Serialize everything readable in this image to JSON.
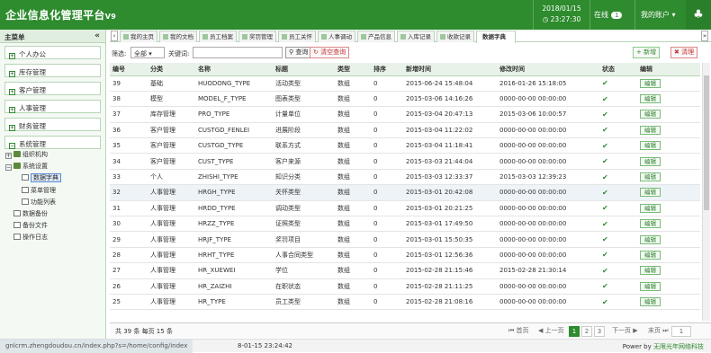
{
  "header": {
    "title": "企业信息化管理平台",
    "version": "V9",
    "date": "2018/01/15",
    "time": "◷ 23:27:30",
    "online_label": "在线",
    "online_count": "1",
    "account_label": "我的账户 ▾",
    "tree_icon": "tree-icon"
  },
  "sidebar": {
    "title": "主菜单",
    "collapse": "«",
    "menus": [
      "个人办公",
      "库存管理",
      "客户管理",
      "人事管理",
      "财务管理",
      "系统管理"
    ],
    "tree": {
      "org": "组织机构",
      "settings": "系统设置",
      "dict": "数据字典",
      "menu": "菜单管理",
      "func": "功能列表",
      "backup": "数据备份",
      "files": "备份文件",
      "log": "操作日志"
    }
  },
  "tabs": [
    "我的主页",
    "我的文档",
    "员工档案",
    "奖罚管理",
    "员工关怀",
    "人事调动",
    "产品信息",
    "入库记录",
    "收款记录",
    "数据字典"
  ],
  "toolbar": {
    "filter_label": "筛选:",
    "filter_value": "全部 ▾",
    "keyword_label": "关键词:",
    "search_btn": "查询",
    "clear_btn": "清空查询",
    "add_btn": "新增",
    "clean_btn": "清理"
  },
  "table": {
    "headers": [
      "编号",
      "分类",
      "名称",
      "标题",
      "类型",
      "排序",
      "新增时间",
      "修改时间",
      "状态",
      "编辑"
    ],
    "rows": [
      [
        "39",
        "基础",
        "HUODONG_TYPE",
        "活动类型",
        "数组",
        "0",
        "2015-06-24 15:48:04",
        "2016-01-26 15:18:05"
      ],
      [
        "38",
        "模型",
        "MODEL_F_TYPE",
        "图表类型",
        "数组",
        "0",
        "2015-03-06 14:16:26",
        "0000-00-00 00:00:00"
      ],
      [
        "37",
        "库存管理",
        "PRO_TYPE",
        "计量单位",
        "数组",
        "0",
        "2015-03-04 20:47:13",
        "2015-03-06 10:00:57"
      ],
      [
        "36",
        "客户管理",
        "CUSTGD_FENLEI",
        "进展阶段",
        "数组",
        "0",
        "2015-03-04 11:22:02",
        "0000-00-00 00:00:00"
      ],
      [
        "35",
        "客户管理",
        "CUSTGD_TYPE",
        "联系方式",
        "数组",
        "0",
        "2015-03-04 11:18:41",
        "0000-00-00 00:00:00"
      ],
      [
        "34",
        "客户管理",
        "CUST_TYPE",
        "客户来源",
        "数组",
        "0",
        "2015-03-03 21:44:04",
        "0000-00-00 00:00:00"
      ],
      [
        "33",
        "个人",
        "ZHISHI_TYPE",
        "知识分类",
        "数组",
        "0",
        "2015-03-03 12:33:37",
        "2015-03-03 12:39:23"
      ],
      [
        "32",
        "人事管理",
        "HRGH_TYPE",
        "关怀类型",
        "数组",
        "0",
        "2015-03-01 20:42:08",
        "0000-00-00 00:00:00"
      ],
      [
        "31",
        "人事管理",
        "HRDD_TYPE",
        "调动类型",
        "数组",
        "0",
        "2015-03-01 20:21:25",
        "0000-00-00 00:00:00"
      ],
      [
        "30",
        "人事管理",
        "HRZZ_TYPE",
        "证照类型",
        "数组",
        "0",
        "2015-03-01 17:49:50",
        "0000-00-00 00:00:00"
      ],
      [
        "29",
        "人事管理",
        "HRJF_TYPE",
        "奖罚项目",
        "数组",
        "0",
        "2015-03-01 15:50:35",
        "0000-00-00 00:00:00"
      ],
      [
        "28",
        "人事管理",
        "HRHT_TYPE",
        "人事合同类型",
        "数组",
        "0",
        "2015-03-01 12:56:36",
        "0000-00-00 00:00:00"
      ],
      [
        "27",
        "人事管理",
        "HR_XUEWEI",
        "学位",
        "数组",
        "0",
        "2015-02-28 21:15:46",
        "2015-02-28 21:30:14"
      ],
      [
        "26",
        "人事管理",
        "HR_ZAIZHI",
        "在职状态",
        "数组",
        "0",
        "2015-02-28 21:11:25",
        "0000-00-00 00:00:00"
      ],
      [
        "25",
        "人事管理",
        "HR_TYPE",
        "员工类型",
        "数组",
        "0",
        "2015-02-28 21:08:16",
        "0000-00-00 00:00:00"
      ]
    ],
    "status_icon": "check-icon",
    "edit_label": "编辑"
  },
  "pager": {
    "total": "共 39 条 每页 15 条",
    "first": "首页",
    "prev": "上一页",
    "pages": [
      "1",
      "2",
      "3"
    ],
    "next": "下一页",
    "last": "末页",
    "goto": "1"
  },
  "statusbar": {
    "url": "gnlcrm.zhengdoudou.cn/index.php?s=/home/config/index",
    "time": "8-01-15 23:24:42",
    "power": "Power by",
    "company": "无限光年网络科技"
  }
}
